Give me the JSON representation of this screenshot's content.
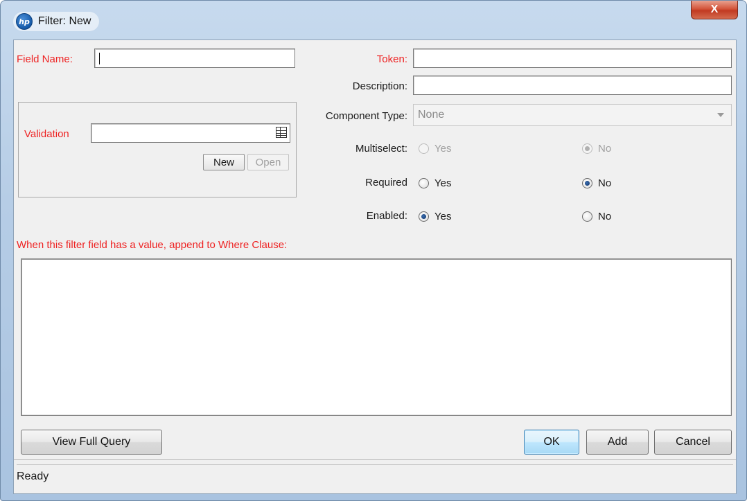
{
  "window": {
    "title": "Filter: New",
    "logo_text": "hp",
    "close_glyph": "X"
  },
  "form": {
    "field_name_label": "Field Name:",
    "field_name_value": "",
    "token_label": "Token:",
    "token_value": "",
    "description_label": "Description:",
    "description_value": "",
    "validation_label": "Validation",
    "validation_value": "",
    "new_button": "New",
    "open_button": "Open",
    "component_type_label": "Component Type:",
    "component_type_value": "None",
    "multiselect": {
      "label": "Multiselect:",
      "yes": "Yes",
      "no": "No",
      "selected": "No",
      "enabled": false
    },
    "required": {
      "label": "Required",
      "yes": "Yes",
      "no": "No",
      "selected": "No",
      "enabled": true
    },
    "enabled": {
      "label": "Enabled:",
      "yes": "Yes",
      "no": "No",
      "selected": "Yes",
      "enabled": true
    },
    "where_clause_label": "When this filter field has a value, append to Where Clause:",
    "where_clause_value": ""
  },
  "buttons": {
    "view_full_query": "View Full Query",
    "ok": "OK",
    "add": "Add",
    "cancel": "Cancel"
  },
  "status": {
    "text": "Ready"
  },
  "colors": {
    "required_label": "#ee2222",
    "title_bar": "#b6cde6",
    "close_button": "#c13a22",
    "default_button_border": "#3c7fb1"
  }
}
